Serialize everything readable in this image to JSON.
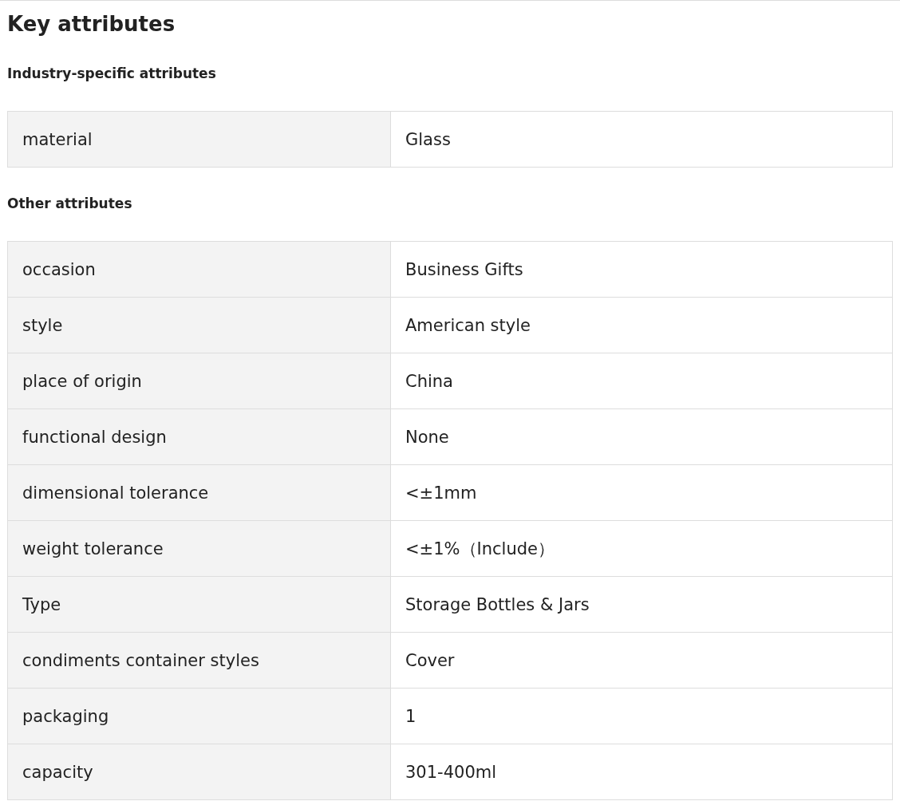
{
  "title": "Key attributes",
  "sections": [
    {
      "heading": "Industry-specific attributes",
      "rows": [
        {
          "name": "material",
          "value": "Glass"
        }
      ]
    },
    {
      "heading": "Other attributes",
      "rows": [
        {
          "name": "occasion",
          "value": "Business Gifts"
        },
        {
          "name": "style",
          "value": "American style"
        },
        {
          "name": "place of origin",
          "value": "China"
        },
        {
          "name": "functional design",
          "value": "None"
        },
        {
          "name": "dimensional tolerance",
          "value": "<±1mm"
        },
        {
          "name": "weight tolerance",
          "value": "<±1%（Include）"
        },
        {
          "name": "Type",
          "value": "Storage Bottles & Jars"
        },
        {
          "name": "condiments container styles",
          "value": "Cover"
        },
        {
          "name": "packaging",
          "value": "1"
        },
        {
          "name": "capacity",
          "value": "301-400ml"
        }
      ]
    }
  ]
}
